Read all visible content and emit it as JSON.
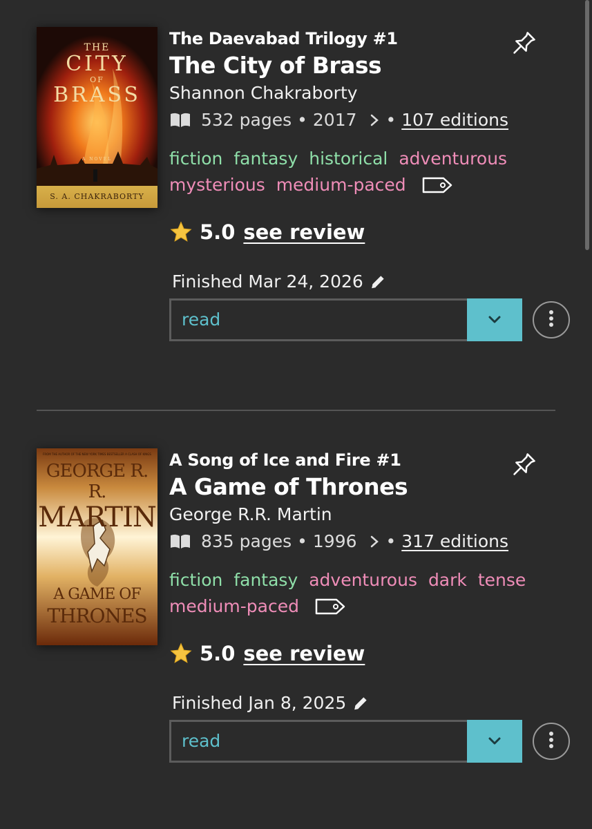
{
  "books": [
    {
      "series": "The Daevabad Trilogy #1",
      "title": "The City of Brass",
      "author": "Shannon Chakraborty",
      "pages": "532 pages",
      "year": "2017",
      "editions": "107 editions",
      "tags": {
        "genres": [
          "fiction",
          "fantasy",
          "historical"
        ],
        "moods": [
          "adventurous",
          "mysterious"
        ],
        "pace": "medium-paced"
      },
      "rating": "5.0",
      "review_link": "see review",
      "finished": "Finished Mar 24, 2026",
      "status": "read",
      "cover": {
        "text_top": "THE",
        "text_mid1": "CITY",
        "text_of": "OF",
        "text_mid2": "BRASS",
        "novel": "A NOVEL",
        "author": "S. A. CHAKRABORTY"
      }
    },
    {
      "series": "A Song of Ice and Fire #1",
      "title": "A Game of Thrones",
      "author": "George R.R. Martin",
      "pages": "835 pages",
      "year": "1996",
      "editions": "317 editions",
      "tags": {
        "genres": [
          "fiction",
          "fantasy"
        ],
        "moods": [
          "adventurous",
          "dark",
          "tense"
        ],
        "pace": "medium-paced"
      },
      "rating": "5.0",
      "review_link": "see review",
      "finished": "Finished Jan 8, 2025",
      "status": "read",
      "cover": {
        "blurb": "FROM THE AUTHOR OF THE NEW YORK TIMES BESTSELLER A CLASH OF KINGS",
        "author1": "GEORGE R. R.",
        "author2": "MARTIN",
        "title1": "A GAME OF",
        "title2": "THRONES"
      }
    }
  ],
  "ui": {
    "meta_separator": "•",
    "colors": {
      "background": "#2b2b2b",
      "genre_tag": "#8fdfa9",
      "mood_tag": "#ef8db8",
      "accent": "#5ec0cc"
    },
    "icons": [
      "pin-icon",
      "book-open-icon",
      "chevron-right-icon",
      "tag-icon",
      "star-icon",
      "pencil-icon",
      "chevron-down-icon",
      "more-vertical-icon"
    ]
  }
}
